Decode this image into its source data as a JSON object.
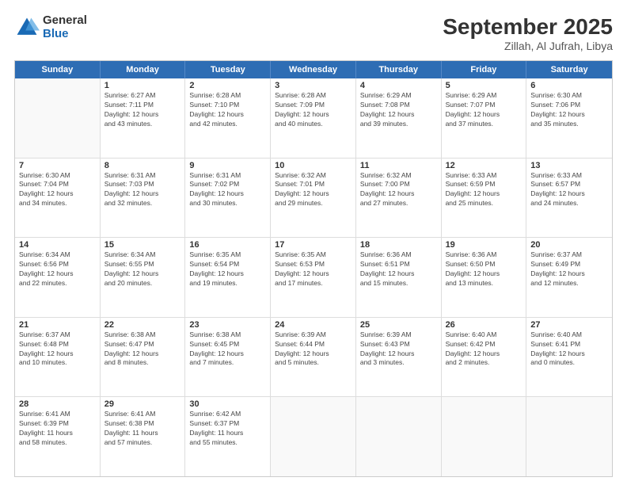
{
  "logo": {
    "general": "General",
    "blue": "Blue"
  },
  "header": {
    "month": "September 2025",
    "location": "Zillah, Al Jufrah, Libya"
  },
  "weekdays": [
    "Sunday",
    "Monday",
    "Tuesday",
    "Wednesday",
    "Thursday",
    "Friday",
    "Saturday"
  ],
  "weeks": [
    [
      {
        "day": "",
        "info": ""
      },
      {
        "day": "1",
        "info": "Sunrise: 6:27 AM\nSunset: 7:11 PM\nDaylight: 12 hours\nand 43 minutes."
      },
      {
        "day": "2",
        "info": "Sunrise: 6:28 AM\nSunset: 7:10 PM\nDaylight: 12 hours\nand 42 minutes."
      },
      {
        "day": "3",
        "info": "Sunrise: 6:28 AM\nSunset: 7:09 PM\nDaylight: 12 hours\nand 40 minutes."
      },
      {
        "day": "4",
        "info": "Sunrise: 6:29 AM\nSunset: 7:08 PM\nDaylight: 12 hours\nand 39 minutes."
      },
      {
        "day": "5",
        "info": "Sunrise: 6:29 AM\nSunset: 7:07 PM\nDaylight: 12 hours\nand 37 minutes."
      },
      {
        "day": "6",
        "info": "Sunrise: 6:30 AM\nSunset: 7:06 PM\nDaylight: 12 hours\nand 35 minutes."
      }
    ],
    [
      {
        "day": "7",
        "info": "Sunrise: 6:30 AM\nSunset: 7:04 PM\nDaylight: 12 hours\nand 34 minutes."
      },
      {
        "day": "8",
        "info": "Sunrise: 6:31 AM\nSunset: 7:03 PM\nDaylight: 12 hours\nand 32 minutes."
      },
      {
        "day": "9",
        "info": "Sunrise: 6:31 AM\nSunset: 7:02 PM\nDaylight: 12 hours\nand 30 minutes."
      },
      {
        "day": "10",
        "info": "Sunrise: 6:32 AM\nSunset: 7:01 PM\nDaylight: 12 hours\nand 29 minutes."
      },
      {
        "day": "11",
        "info": "Sunrise: 6:32 AM\nSunset: 7:00 PM\nDaylight: 12 hours\nand 27 minutes."
      },
      {
        "day": "12",
        "info": "Sunrise: 6:33 AM\nSunset: 6:59 PM\nDaylight: 12 hours\nand 25 minutes."
      },
      {
        "day": "13",
        "info": "Sunrise: 6:33 AM\nSunset: 6:57 PM\nDaylight: 12 hours\nand 24 minutes."
      }
    ],
    [
      {
        "day": "14",
        "info": "Sunrise: 6:34 AM\nSunset: 6:56 PM\nDaylight: 12 hours\nand 22 minutes."
      },
      {
        "day": "15",
        "info": "Sunrise: 6:34 AM\nSunset: 6:55 PM\nDaylight: 12 hours\nand 20 minutes."
      },
      {
        "day": "16",
        "info": "Sunrise: 6:35 AM\nSunset: 6:54 PM\nDaylight: 12 hours\nand 19 minutes."
      },
      {
        "day": "17",
        "info": "Sunrise: 6:35 AM\nSunset: 6:53 PM\nDaylight: 12 hours\nand 17 minutes."
      },
      {
        "day": "18",
        "info": "Sunrise: 6:36 AM\nSunset: 6:51 PM\nDaylight: 12 hours\nand 15 minutes."
      },
      {
        "day": "19",
        "info": "Sunrise: 6:36 AM\nSunset: 6:50 PM\nDaylight: 12 hours\nand 13 minutes."
      },
      {
        "day": "20",
        "info": "Sunrise: 6:37 AM\nSunset: 6:49 PM\nDaylight: 12 hours\nand 12 minutes."
      }
    ],
    [
      {
        "day": "21",
        "info": "Sunrise: 6:37 AM\nSunset: 6:48 PM\nDaylight: 12 hours\nand 10 minutes."
      },
      {
        "day": "22",
        "info": "Sunrise: 6:38 AM\nSunset: 6:47 PM\nDaylight: 12 hours\nand 8 minutes."
      },
      {
        "day": "23",
        "info": "Sunrise: 6:38 AM\nSunset: 6:45 PM\nDaylight: 12 hours\nand 7 minutes."
      },
      {
        "day": "24",
        "info": "Sunrise: 6:39 AM\nSunset: 6:44 PM\nDaylight: 12 hours\nand 5 minutes."
      },
      {
        "day": "25",
        "info": "Sunrise: 6:39 AM\nSunset: 6:43 PM\nDaylight: 12 hours\nand 3 minutes."
      },
      {
        "day": "26",
        "info": "Sunrise: 6:40 AM\nSunset: 6:42 PM\nDaylight: 12 hours\nand 2 minutes."
      },
      {
        "day": "27",
        "info": "Sunrise: 6:40 AM\nSunset: 6:41 PM\nDaylight: 12 hours\nand 0 minutes."
      }
    ],
    [
      {
        "day": "28",
        "info": "Sunrise: 6:41 AM\nSunset: 6:39 PM\nDaylight: 11 hours\nand 58 minutes."
      },
      {
        "day": "29",
        "info": "Sunrise: 6:41 AM\nSunset: 6:38 PM\nDaylight: 11 hours\nand 57 minutes."
      },
      {
        "day": "30",
        "info": "Sunrise: 6:42 AM\nSunset: 6:37 PM\nDaylight: 11 hours\nand 55 minutes."
      },
      {
        "day": "",
        "info": ""
      },
      {
        "day": "",
        "info": ""
      },
      {
        "day": "",
        "info": ""
      },
      {
        "day": "",
        "info": ""
      }
    ]
  ]
}
